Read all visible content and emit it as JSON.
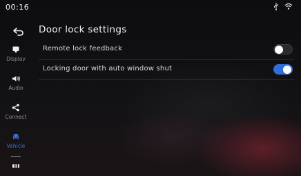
{
  "status_bar": {
    "time": "00:16",
    "icons": [
      "usb-icon",
      "wifi-icon"
    ]
  },
  "sidebar": {
    "back_icon": "back-arrow-icon",
    "items": [
      {
        "label": "Display",
        "icon": "display-icon",
        "active": false
      },
      {
        "label": "Audio",
        "icon": "speaker-icon",
        "active": false
      },
      {
        "label": "Connect",
        "icon": "share-icon",
        "active": false
      },
      {
        "label": "Vehicle",
        "icon": "car-icon",
        "active": true
      },
      {
        "label": "",
        "icon": "more-icon",
        "active": false
      }
    ]
  },
  "main": {
    "title": "Door lock settings",
    "settings": [
      {
        "label": "Remote lock feedback",
        "enabled": false
      },
      {
        "label": "Locking door with auto window shut",
        "enabled": true
      }
    ]
  },
  "colors": {
    "accent": "#2e6fd8",
    "active_nav": "#3a6fd6",
    "background": "#111113"
  }
}
